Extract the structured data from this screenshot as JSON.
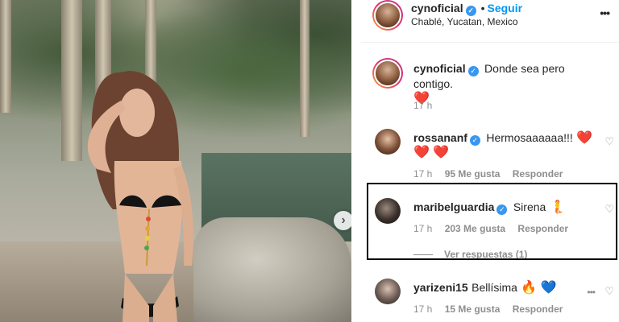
{
  "post": {
    "username": "cynoficial",
    "follow_label": "Seguir",
    "location": "Chablé, Yucatan, Mexico"
  },
  "caption": {
    "username": "cynoficial",
    "text": "Donde sea pero contigo.",
    "emoji": "❤️",
    "time": "17 h"
  },
  "comments": [
    {
      "username": "rossananf",
      "text": "Hermosaaaaaa!!!",
      "emoji_line1": "❤️",
      "emoji_line2": "❤️ ❤️",
      "time": "17 h",
      "likes": "95 Me gusta",
      "reply_label": "Responder"
    },
    {
      "username": "maribelguardia",
      "text": "Sirena",
      "emoji": "🧜",
      "time": "17 h",
      "likes": "203 Me gusta",
      "reply_label": "Responder",
      "view_replies": "Ver respuestas (1)"
    },
    {
      "username": "yarizeni15",
      "text": "Bellísima",
      "emoji": "🔥 💙",
      "time": "17 h",
      "likes": "15 Me gusta",
      "reply_label": "Responder"
    }
  ],
  "icons": {
    "more": "more-options-icon",
    "verified": "verified-badge-icon",
    "heart": "heart-outline-icon",
    "next": "chevron-right-icon"
  },
  "colors": {
    "follow": "#0095f6",
    "verified": "#3897f0",
    "highlight_border": "#000000"
  }
}
